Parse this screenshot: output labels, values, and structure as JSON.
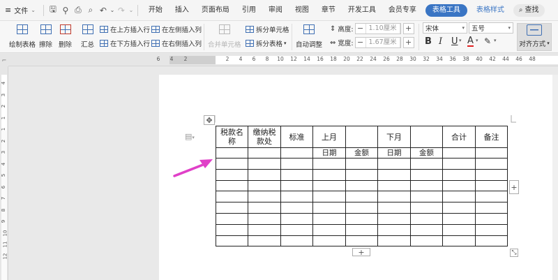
{
  "menubar": {
    "file_label": "文件",
    "tabs": [
      "开始",
      "插入",
      "页面布局",
      "引用",
      "审阅",
      "视图",
      "章节",
      "开发工具",
      "会员专享"
    ],
    "active_tab": "表格工具",
    "style_tab": "表格样式",
    "search_label": "查找"
  },
  "ribbon": {
    "draw_table": "绘制表格",
    "erase": "擦除",
    "delete": "删除",
    "summary": "汇总",
    "insert_above": "在上方插入行",
    "insert_below": "在下方插入行",
    "insert_left": "在左侧插入列",
    "insert_right": "在右侧插入列",
    "merge_cells": "合并单元格",
    "split_cells": "拆分单元格",
    "split_table": "拆分表格",
    "auto_fit": "自动调整",
    "height_label": "高度:",
    "height_value": "1.10厘米",
    "width_label": "宽度:",
    "width_value": "1.67厘米",
    "font_name": "宋体",
    "font_size": "五号",
    "bold": "B",
    "italic": "I",
    "underline": "U",
    "font_color": "A",
    "align_label": "对齐方式"
  },
  "ruler": {
    "h_left_numbers": [
      "6",
      "4",
      "2"
    ],
    "h_right_numbers": [
      "2",
      "4",
      "6",
      "8",
      "10",
      "12",
      "14",
      "16",
      "18",
      "20",
      "22",
      "24",
      "26",
      "28",
      "30",
      "32",
      "34",
      "36",
      "38",
      "40",
      "42",
      "44",
      "46",
      "48"
    ],
    "v_numbers": [
      "4",
      "3",
      "2",
      "1",
      "1",
      "2",
      "3",
      "4",
      "5",
      "6",
      "7",
      "8",
      "9",
      "10",
      "11",
      "12"
    ]
  },
  "table": {
    "header_row1": [
      "税款名称",
      "缴纳税款处",
      "标准",
      "上月",
      "",
      "下月",
      "",
      "合计",
      "备注"
    ],
    "header_row2": [
      "",
      "",
      "",
      "日期",
      "金额",
      "日期",
      "金额",
      "",
      ""
    ],
    "empty_rows": 8
  },
  "handles": {
    "move": "✥",
    "add_col": "+",
    "add_row": "+",
    "resize": "⤡"
  },
  "colors": {
    "accent": "#3a75c4",
    "arrow": "#e040c8"
  }
}
